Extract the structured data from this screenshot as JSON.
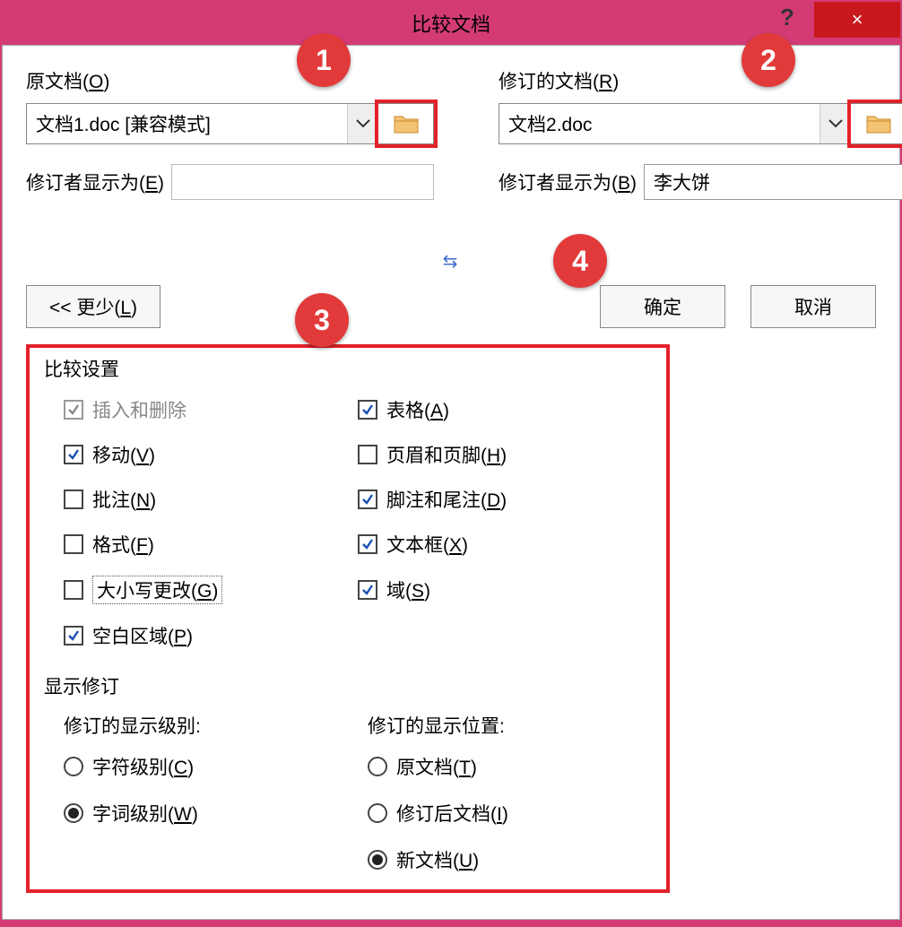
{
  "window": {
    "title": "比较文档",
    "help": "?",
    "close": "×"
  },
  "original": {
    "label": "原文档(O)",
    "value": "文档1.doc [兼容模式]",
    "reviewer_label": "修订者显示为(E)",
    "reviewer_value": ""
  },
  "revised": {
    "label": "修订的文档(R)",
    "value": "文档2.doc",
    "reviewer_label": "修订者显示为(B)",
    "reviewer_value": "李大饼"
  },
  "buttons": {
    "less": "<< 更少(L)",
    "ok": "确定",
    "cancel": "取消"
  },
  "badges": {
    "b1": "1",
    "b2": "2",
    "b3": "3",
    "b4": "4"
  },
  "settings": {
    "title": "比较设置",
    "checks": {
      "ins_del": {
        "label": "插入和删除",
        "checked": true,
        "disabled": true
      },
      "move": {
        "label": "移动(V)",
        "checked": true
      },
      "comment": {
        "label": "批注(N)",
        "checked": false
      },
      "format": {
        "label": "格式(F)",
        "checked": false
      },
      "casechg": {
        "label": "大小写更改(G)",
        "checked": false,
        "dotted": true
      },
      "blank": {
        "label": "空白区域(P)",
        "checked": true
      },
      "table": {
        "label": "表格(A)",
        "checked": true
      },
      "headfoot": {
        "label": "页眉和页脚(H)",
        "checked": false
      },
      "footend": {
        "label": "脚注和尾注(D)",
        "checked": true
      },
      "textbox": {
        "label": "文本框(X)",
        "checked": true
      },
      "fields": {
        "label": "域(S)",
        "checked": true
      }
    }
  },
  "show": {
    "title": "显示修订",
    "level_label": "修订的显示级别:",
    "level": {
      "char": {
        "label": "字符级别(C)",
        "selected": false
      },
      "word": {
        "label": "字词级别(W)",
        "selected": true
      }
    },
    "where_label": "修订的显示位置:",
    "where": {
      "orig": {
        "label": "原文档(T)",
        "selected": false
      },
      "rev": {
        "label": "修订后文档(I)",
        "selected": false
      },
      "new": {
        "label": "新文档(U)",
        "selected": true
      }
    }
  }
}
